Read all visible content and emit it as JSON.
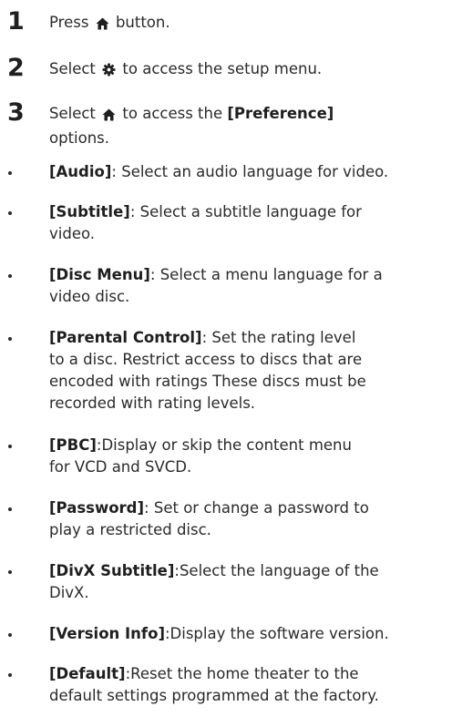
{
  "steps": [
    {
      "number": "1",
      "pre": "Press",
      "icon": "home-icon",
      "post": "button.",
      "bold": "",
      "tail": ""
    },
    {
      "number": "2",
      "pre": "Select",
      "icon": "gear-icon",
      "post": "to access the setup menu.",
      "bold": "",
      "tail": ""
    },
    {
      "number": "3",
      "pre": "Select",
      "icon": "home-icon",
      "post": "to access the",
      "bold": "[Preference]",
      "tail": "options."
    }
  ],
  "options": [
    {
      "name": "[Audio]",
      "sep": ": ",
      "lines": [
        "Select an audio language for video."
      ],
      "first": "Select an audio language for video."
    },
    {
      "name": "[Subtitle]",
      "sep": ": ",
      "first": "Select a subtitle language for",
      "lines": [
        "video."
      ]
    },
    {
      "name": "[Disc Menu]",
      "sep": ": ",
      "first": "Select a menu language for a",
      "lines": [
        "video disc."
      ]
    },
    {
      "name": "[Parental Control]",
      "sep": ": ",
      "first": "Set the rating level",
      "lines": [
        "to a disc. Restrict access to discs that are",
        "encoded with ratings These discs must be",
        "recorded with rating levels."
      ]
    },
    {
      "name": "[PBC]",
      "sep": ":",
      "first": "Display or skip the content menu",
      "lines": [
        "for VCD and SVCD."
      ]
    },
    {
      "name": "[Password]",
      "sep": ": ",
      "first": "Set or change a password to",
      "lines": [
        "play a restricted disc."
      ]
    },
    {
      "name": "[DivX Subtitle]",
      "sep": ":",
      "first": "Select the language of the",
      "lines": [
        "DivX."
      ]
    },
    {
      "name": "[Version Info]",
      "sep": ":",
      "first": "Display the software version.",
      "lines": []
    },
    {
      "name": "[Default]",
      "sep": ":",
      "first": "Reset the home theater to the",
      "lines": [
        "default settings programmed at the factory."
      ]
    }
  ]
}
